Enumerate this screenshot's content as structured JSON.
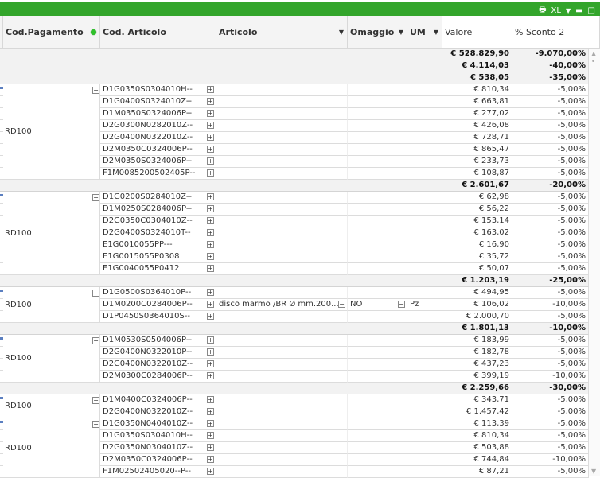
{
  "caption": {
    "print_icon": "printer-icon",
    "xl_label": "XL",
    "color": "#33a52b"
  },
  "headers": {
    "cod_pagamento": "Cod.Pagamento",
    "cod_articolo": "Cod. Articolo",
    "articolo": "Articolo",
    "omaggio": "Omaggio",
    "um": "UM",
    "valore": "Valore",
    "sconto": "% Sconto 2"
  },
  "grand_total": {
    "valore": "€ 528.829,90",
    "sconto": "-9.070,00%"
  },
  "groups": [
    {
      "cod_pagamento": "",
      "subtotal": {
        "valore": "€ 4.114,03",
        "sconto": "-40,00%"
      },
      "rows": []
    },
    {
      "cod_pagamento": "RD100",
      "subtotal": {
        "valore": "€ 538,05",
        "sconto": "-35,00%"
      },
      "rows": [
        {
          "cod": "D1G0350S0304010H--",
          "valore": "€ 810,34",
          "sconto": "-5,00%"
        },
        {
          "cod": "D1G0400S0324010Z--",
          "valore": "€ 663,81",
          "sconto": "-5,00%"
        },
        {
          "cod": "D1M0350S0324006P--",
          "valore": "€ 277,02",
          "sconto": "-5,00%"
        },
        {
          "cod": "D2G0300N0282010Z--",
          "valore": "€ 426,08",
          "sconto": "-5,00%"
        },
        {
          "cod": "D2G0400N0322010Z--",
          "valore": "€ 728,71",
          "sconto": "-5,00%"
        },
        {
          "cod": "D2M0350C0324006P--",
          "valore": "€ 865,47",
          "sconto": "-5,00%"
        },
        {
          "cod": "D2M0350S0324006P--",
          "valore": "€ 233,73",
          "sconto": "-5,00%"
        },
        {
          "cod": "F1M0085200502405P--",
          "valore": "€ 108,87",
          "sconto": "-5,00%"
        }
      ]
    },
    {
      "cod_pagamento": "RD100",
      "subtotal": {
        "valore": "€ 2.601,67",
        "sconto": "-20,00%"
      },
      "rows": [
        {
          "cod": "D1G0200S0284010Z--",
          "valore": "€ 62,98",
          "sconto": "-5,00%"
        },
        {
          "cod": "D1M0250S0284006P--",
          "valore": "€ 56,22",
          "sconto": "-5,00%"
        },
        {
          "cod": "D2G0350C0304010Z--",
          "valore": "€ 153,14",
          "sconto": "-5,00%"
        },
        {
          "cod": "D2G0400S0324010T--",
          "valore": "€ 163,02",
          "sconto": "-5,00%"
        },
        {
          "cod": "E1G0010055PP---",
          "valore": "€ 16,90",
          "sconto": "-5,00%"
        },
        {
          "cod": "E1G0015055P0308",
          "valore": "€ 35,72",
          "sconto": "-5,00%"
        },
        {
          "cod": "E1G0040055P0412",
          "valore": "€ 50,07",
          "sconto": "-5,00%"
        }
      ]
    },
    {
      "cod_pagamento": "RD100",
      "subtotal": {
        "valore": "€ 1.203,19",
        "sconto": "-25,00%"
      },
      "rows": [
        {
          "cod": "D1G0500S0364010P--",
          "valore": "€ 494,95",
          "sconto": "-5,00%"
        },
        {
          "cod": "D1M0200C0284006P--",
          "articolo": "disco marmo /BR Ø mm.200...",
          "omaggio": "NO",
          "um": "Pz",
          "valore": "€ 106,02",
          "sconto": "-10,00%"
        },
        {
          "cod": "D1P0450S0364010S--",
          "valore": "€ 2.000,70",
          "sconto": "-5,00%"
        }
      ]
    },
    {
      "cod_pagamento": "RD100",
      "subtotal": {
        "valore": "€ 1.801,13",
        "sconto": "-10,00%"
      },
      "rows": [
        {
          "cod": "D1M0530S0504006P--",
          "valore": "€ 183,99",
          "sconto": "-5,00%"
        },
        {
          "cod": "D2G0400N0322010P--",
          "valore": "€ 182,78",
          "sconto": "-5,00%"
        },
        {
          "cod": "D2G0400N0322010Z--",
          "valore": "€ 437,23",
          "sconto": "-5,00%"
        },
        {
          "cod": "D2M0300C0284006P--",
          "valore": "€ 399,19",
          "sconto": "-10,00%"
        }
      ]
    },
    {
      "cod_pagamento": "RD100",
      "subtotal": {
        "valore": "€ 2.259,66",
        "sconto": "-30,00%"
      },
      "rows": [
        {
          "cod": "D1M0400C0324006P--",
          "valore": "€ 343,71",
          "sconto": "-5,00%"
        },
        {
          "cod": "D2G0400N0322010Z--",
          "valore": "€ 1.457,42",
          "sconto": "-5,00%"
        }
      ]
    },
    {
      "cod_pagamento": "RD100",
      "subtotal": null,
      "rows": [
        {
          "cod": "D1G0350N0404010Z--",
          "valore": "€ 113,39",
          "sconto": "-5,00%"
        },
        {
          "cod": "D1G0350S0304010H--",
          "valore": "€ 810,34",
          "sconto": "-5,00%"
        },
        {
          "cod": "D2G0350N0304010Z--",
          "valore": "€ 503,88",
          "sconto": "-5,00%"
        },
        {
          "cod": "D2M0350C0324006P--",
          "valore": "€ 744,84",
          "sconto": "-10,00%"
        },
        {
          "cod": "F1M02502405020--P--",
          "valore": "€ 87,21",
          "sconto": "-5,00%"
        }
      ]
    }
  ]
}
